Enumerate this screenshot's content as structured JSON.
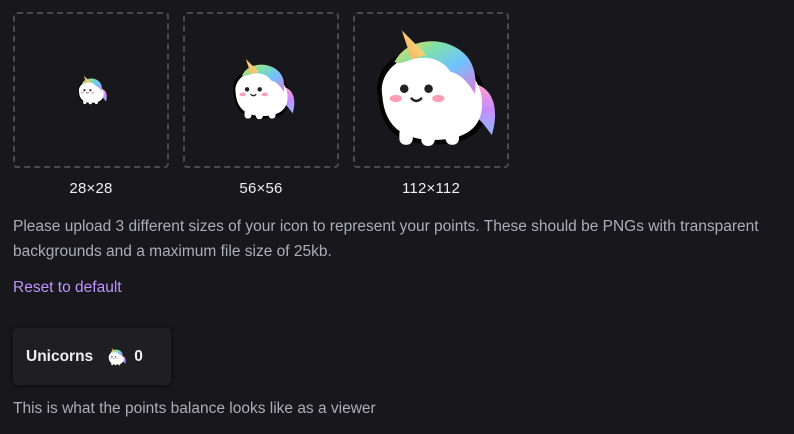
{
  "icons": [
    {
      "size_label": "28×28"
    },
    {
      "size_label": "56×56"
    },
    {
      "size_label": "112×112"
    }
  ],
  "description": "Please upload 3 different sizes of your icon to represent your points. These should be PNGs with transparent backgrounds and a maximum file size of 25kb.",
  "reset_link": "Reset to default",
  "balance": {
    "name": "Unicorns",
    "icon": "unicorn-icon",
    "value": "0"
  },
  "footer_note": "This is what the points balance looks like as a viewer",
  "colors": {
    "background": "#18171c",
    "link": "#bf94ff",
    "muted_text": "#adadb8",
    "text": "#efeff1"
  }
}
